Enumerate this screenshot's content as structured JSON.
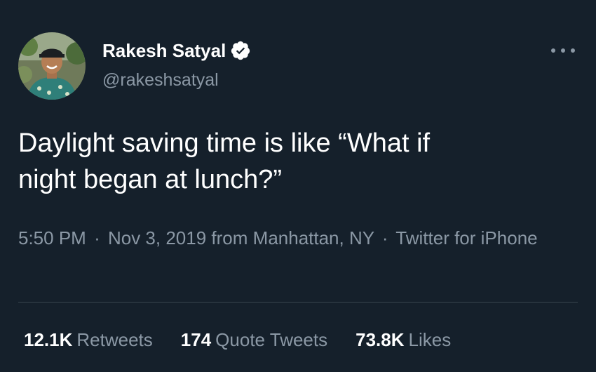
{
  "author": {
    "display_name": "Rakesh Satyal",
    "handle": "@rakeshsatyal",
    "verified": true
  },
  "tweet": {
    "text_line1": "Daylight saving time is like “What if",
    "text_line2": "night began at lunch?”"
  },
  "meta": {
    "time": "5:50 PM",
    "separator1": "·",
    "date": "Nov 3, 2019",
    "from_label": "from",
    "location": "Manhattan, NY",
    "separator2": "·",
    "source": "Twitter for iPhone"
  },
  "stats": [
    {
      "value": "12.1K",
      "label": "Retweets"
    },
    {
      "value": "174",
      "label": "Quote Tweets"
    },
    {
      "value": "73.8K",
      "label": "Likes"
    }
  ],
  "icons": {
    "more": "more-icon",
    "verified": "verified-badge-icon"
  },
  "colors": {
    "background": "#15202b",
    "primary_text": "#ffffff",
    "secondary_text": "#8b98a5",
    "divider": "#38444d",
    "verified_badge": "#ffffff"
  }
}
